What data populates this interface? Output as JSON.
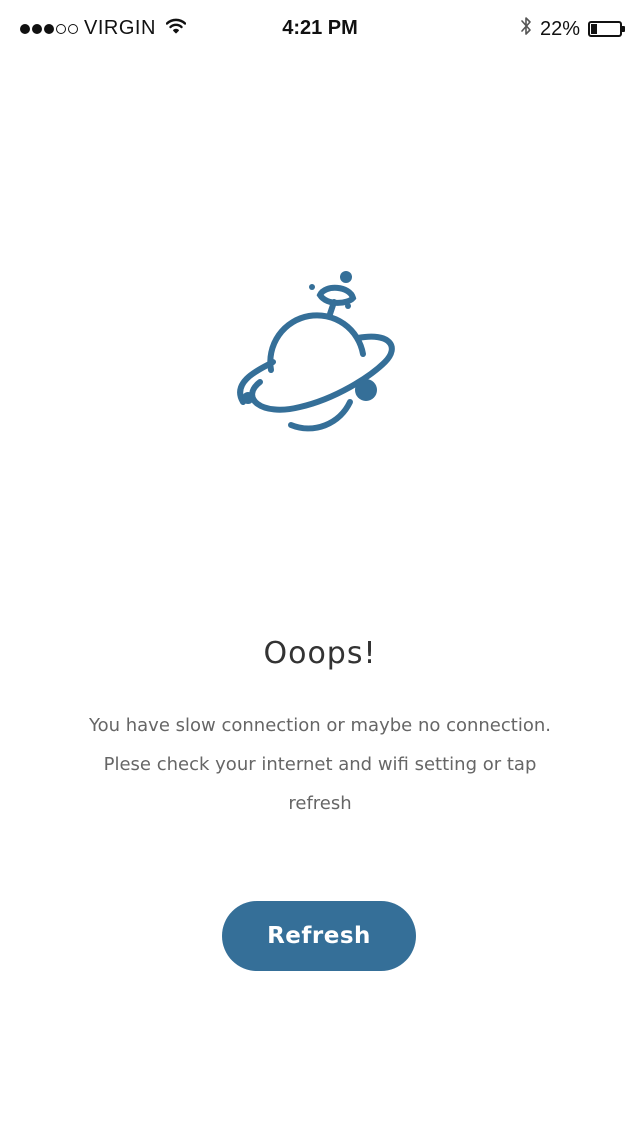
{
  "status_bar": {
    "carrier": "VIRGIN",
    "signal_strength": 3,
    "signal_max": 5,
    "time": "4:21 PM",
    "battery_percent": "22%",
    "battery_level": 0.22,
    "icons": [
      "wifi-icon",
      "bluetooth-icon",
      "battery-icon"
    ]
  },
  "illustration": {
    "icon": "planet-with-satellite-icon",
    "color": "#356f98"
  },
  "error": {
    "title": "Ooops!",
    "message": "You have slow connection or maybe no connection. Plese check your internet and wifi setting or tap refresh"
  },
  "actions": {
    "refresh_label": "Refresh",
    "button_color": "#356f98"
  }
}
